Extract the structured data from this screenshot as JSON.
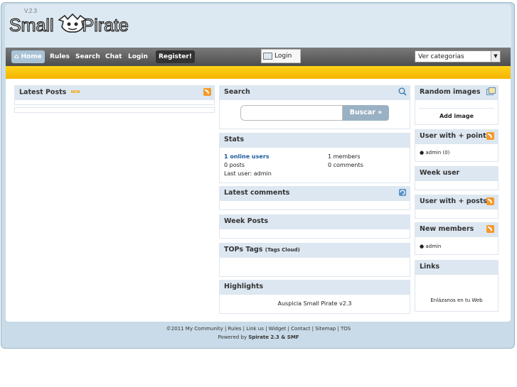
{
  "logo": {
    "version": "V.2.3",
    "name_part1": "Small",
    "name_part2": "Pirate"
  },
  "nav": {
    "home": "Home",
    "rules": "Rules",
    "search": "Search",
    "chat": "Chat",
    "login": "Login",
    "register": "Register!",
    "login_button": "Login",
    "category_select": "Ver categorias"
  },
  "latest_posts": {
    "title": "Latest Posts",
    "badge": "NEW"
  },
  "search": {
    "title": "Search",
    "button": "Buscar »",
    "placeholder": ""
  },
  "stats": {
    "title": "Stats",
    "online": "1 online users",
    "members": "1 members",
    "posts": "0 posts",
    "comments": "0 comments",
    "last_user": "Last user: admin"
  },
  "latest_comments": {
    "title": "Latest comments"
  },
  "week_posts": {
    "title": "Week Posts"
  },
  "tops_tags": {
    "title": "TOPs Tags",
    "subtitle": "(Tags Cloud)"
  },
  "highlights": {
    "title": "Highlights",
    "text": "Auspicia Small Pirate v2.3"
  },
  "random_images": {
    "title": "Random images",
    "add": "Add image"
  },
  "user_more_points": {
    "title": "User with + points",
    "item": "admin (0)"
  },
  "week_user": {
    "title": "Week user"
  },
  "user_more_posts": {
    "title": "User with + posts"
  },
  "new_members": {
    "title": "New members",
    "item": "admin"
  },
  "links": {
    "title": "Links",
    "text": "Enlázanos en tu Web"
  },
  "footer": {
    "line1": "©2011 My Community | Rules | Link us | Widget | Contact | Sitemap | TOS",
    "line2_prefix": "Powered by ",
    "line2_brand": "Spirate 2.3 & SMF"
  },
  "colors": {
    "accent_yellow": "#f4b400",
    "panel_title_bg": "#dde7f1",
    "link": "#1a5a9a",
    "rss": "#f59a2a"
  }
}
